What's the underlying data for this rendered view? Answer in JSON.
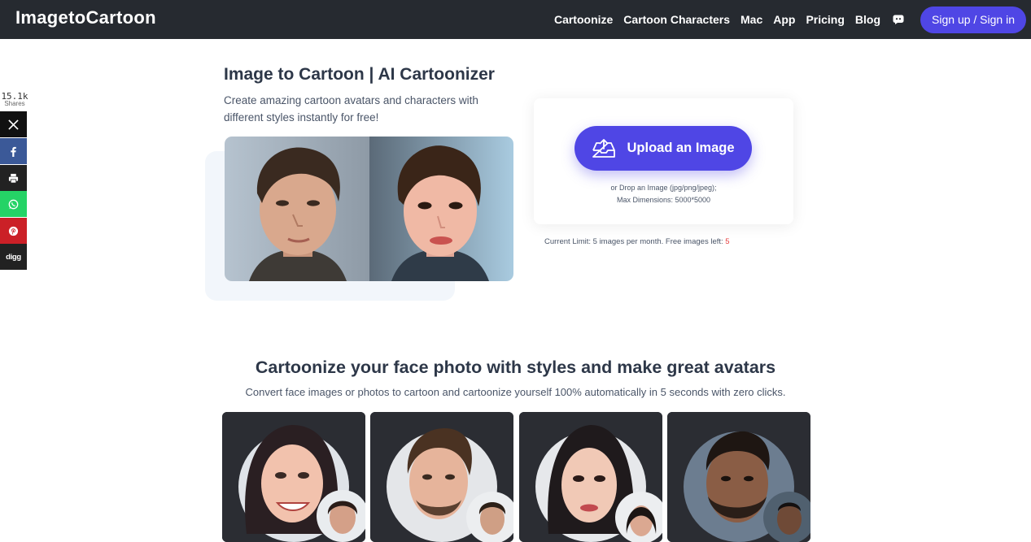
{
  "nav": {
    "brand": "ImagetoCartoon",
    "links": [
      "Cartoonize",
      "Cartoon Characters",
      "Mac",
      "App",
      "Pricing",
      "Blog"
    ],
    "discord_icon": "discord-icon",
    "signin_label": "Sign up / Sign in",
    "accent": "#4f46e5",
    "background": "#262a30"
  },
  "share": {
    "count": "15.1k",
    "label": "Shares",
    "buttons": [
      {
        "name": "x-share",
        "icon": "x-icon",
        "color": "#111111"
      },
      {
        "name": "facebook-share",
        "icon": "facebook-icon",
        "color": "#3b5998"
      },
      {
        "name": "print-share",
        "icon": "print-icon",
        "color": "#222222"
      },
      {
        "name": "whatsapp-share",
        "icon": "whatsapp-icon",
        "color": "#25d366"
      },
      {
        "name": "pinterest-share",
        "icon": "pinterest-icon",
        "color": "#cb2027"
      },
      {
        "name": "digg-share",
        "icon": "digg-icon",
        "color": "#222222",
        "text": "digg"
      }
    ]
  },
  "hero": {
    "title": "Image to Cartoon | AI Cartoonizer",
    "subtitle": "Create amazing cartoon avatars and characters with different styles instantly for free!"
  },
  "upload": {
    "button_label": "Upload an Image",
    "drop_line1": "or Drop an Image (jpg/png/jpeg);",
    "drop_line2": "Max Dimensions: 5000*5000",
    "limit_text": "Current Limit: 5 images per month. Free images left: ",
    "free_left": "5"
  },
  "section": {
    "title": "Cartoonize your face photo with styles and make great avatars",
    "subtitle": "Convert face images or photos to cartoon and cartoonize yourself 100% automatically in 5 seconds with zero clicks."
  }
}
